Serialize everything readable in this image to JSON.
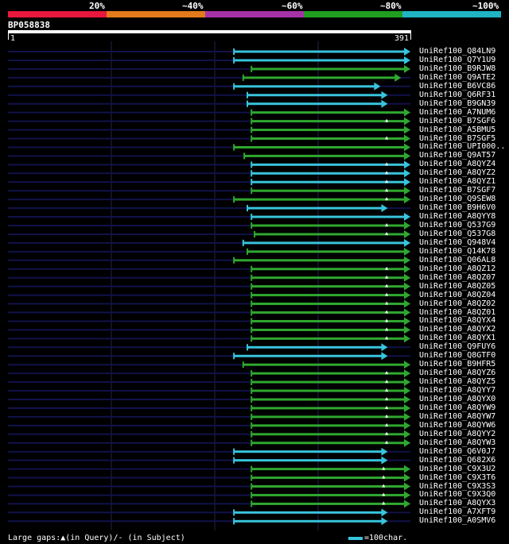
{
  "scale_labels": [
    "20%",
    "~40%",
    "~60%",
    "~80%",
    "~100%"
  ],
  "scale_colors": [
    "#e8173c",
    "#e37b1c",
    "#a632a8",
    "#1f9e1f",
    "#1fb3c4"
  ],
  "query": {
    "id": "BP058838",
    "start": "1",
    "end": "391",
    "length": 391
  },
  "colors": {
    "background": "#000000",
    "cyan": "#38c4dc",
    "green": "#2fa82f",
    "navy": "#11124a",
    "grid": "#22234e"
  },
  "hits": [
    {
      "label": "UniRef100_Q84LN9",
      "start": 220,
      "end": 391,
      "color": "cyan",
      "fade": "navy"
    },
    {
      "label": "UniRef100_Q7Y1U9",
      "start": 220,
      "end": 391,
      "color": "cyan",
      "fade": "navy"
    },
    {
      "label": "UniRef100_B9RJW8",
      "start": 237,
      "end": 391,
      "color": "green",
      "fade": "navy"
    },
    {
      "label": "UniRef100_Q9ATE2",
      "start": 229,
      "end": 382,
      "color": "green",
      "fade": "navy"
    },
    {
      "label": "UniRef100_B6VC86",
      "start": 220,
      "end": 362,
      "color": "cyan",
      "fade": "navy"
    },
    {
      "label": "UniRef100_Q6RF31",
      "start": 233,
      "end": 369,
      "color": "cyan",
      "fade": "navy"
    },
    {
      "label": "UniRef100_B9GN39",
      "start": 233,
      "end": 369,
      "color": "cyan",
      "fade": "navy"
    },
    {
      "label": "UniRef100_A7NUM6",
      "start": 237,
      "end": 391,
      "color": "green",
      "fade": "navy"
    },
    {
      "label": "UniRef100_B7SGF6",
      "start": 237,
      "end": 391,
      "color": "green",
      "fade": "navy",
      "marker": 368
    },
    {
      "label": "UniRef100_A5BMU5",
      "start": 237,
      "end": 391,
      "color": "green",
      "fade": "navy"
    },
    {
      "label": "UniRef100_B7SGF5",
      "start": 237,
      "end": 391,
      "color": "green",
      "fade": "navy",
      "marker": 368
    },
    {
      "label": "UniRef100_UPI000..",
      "start": 220,
      "end": 391,
      "color": "green",
      "fade": "navy"
    },
    {
      "label": "UniRef100_Q9AT57",
      "start": 230,
      "end": 391,
      "color": "green",
      "fade": "navy"
    },
    {
      "label": "UniRef100_A8QYZ4",
      "start": 237,
      "end": 391,
      "color": "cyan",
      "fade": "navy",
      "marker": 368
    },
    {
      "label": "UniRef100_A8QYZ2",
      "start": 237,
      "end": 391,
      "color": "cyan",
      "fade": "navy",
      "marker": 368
    },
    {
      "label": "UniRef100_A8QYZ1",
      "start": 237,
      "end": 391,
      "color": "cyan",
      "fade": "navy",
      "marker": 368
    },
    {
      "label": "UniRef100_B7SGF7",
      "start": 237,
      "end": 391,
      "color": "green",
      "fade": "navy",
      "marker": 368
    },
    {
      "label": "UniRef100_Q9SEW8",
      "start": 220,
      "end": 391,
      "color": "green",
      "fade": "navy",
      "marker": 368
    },
    {
      "label": "UniRef100_B9H6V0",
      "start": 233,
      "end": 369,
      "color": "cyan",
      "fade": "navy"
    },
    {
      "label": "UniRef100_A8QYY8",
      "start": 237,
      "end": 391,
      "color": "cyan",
      "fade": "navy"
    },
    {
      "label": "UniRef100_Q537G9",
      "start": 237,
      "end": 391,
      "color": "green",
      "fade": "navy",
      "marker": 368
    },
    {
      "label": "UniRef100_Q537G8",
      "start": 240,
      "end": 391,
      "color": "green",
      "fade": "navy",
      "marker": 368
    },
    {
      "label": "UniRef100_Q948V4",
      "start": 229,
      "end": 391,
      "color": "cyan",
      "fade": "navy"
    },
    {
      "label": "UniRef100_Q14K78",
      "start": 233,
      "end": 391,
      "color": "green",
      "fade": "navy"
    },
    {
      "label": "UniRef100_Q06AL8",
      "start": 220,
      "end": 391,
      "color": "green",
      "fade": "navy"
    },
    {
      "label": "UniRef100_A8QZ12",
      "start": 237,
      "end": 391,
      "color": "green",
      "fade": "navy",
      "marker": 368
    },
    {
      "label": "UniRef100_A8QZ07",
      "start": 237,
      "end": 391,
      "color": "green",
      "fade": "navy",
      "marker": 368
    },
    {
      "label": "UniRef100_A8QZ05",
      "start": 237,
      "end": 391,
      "color": "green",
      "fade": "navy",
      "marker": 368
    },
    {
      "label": "UniRef100_A8QZ04",
      "start": 237,
      "end": 391,
      "color": "green",
      "fade": "navy",
      "marker": 368
    },
    {
      "label": "UniRef100_A8QZ02",
      "start": 237,
      "end": 391,
      "color": "green",
      "fade": "navy",
      "marker": 368
    },
    {
      "label": "UniRef100_A8QZ01",
      "start": 237,
      "end": 391,
      "color": "green",
      "fade": "navy",
      "marker": 368
    },
    {
      "label": "UniRef100_A8QYX4",
      "start": 237,
      "end": 391,
      "color": "green",
      "fade": "navy",
      "marker": 368
    },
    {
      "label": "UniRef100_A8QYX2",
      "start": 237,
      "end": 391,
      "color": "green",
      "fade": "navy",
      "marker": 368
    },
    {
      "label": "UniRef100_A8QYX1",
      "start": 237,
      "end": 391,
      "color": "green",
      "fade": "navy",
      "marker": 368
    },
    {
      "label": "UniRef100_Q9FUY6",
      "start": 233,
      "end": 369,
      "color": "cyan",
      "fade": "navy"
    },
    {
      "label": "UniRef100_Q8GTF0",
      "start": 220,
      "end": 369,
      "color": "cyan",
      "fade": "navy"
    },
    {
      "label": "UniRef100_B9HFR5",
      "start": 229,
      "end": 391,
      "color": "green",
      "fade": "navy"
    },
    {
      "label": "UniRef100_A8QYZ6",
      "start": 237,
      "end": 391,
      "color": "green",
      "fade": "navy",
      "marker": 368
    },
    {
      "label": "UniRef100_A8QYZ5",
      "start": 237,
      "end": 391,
      "color": "green",
      "fade": "navy",
      "marker": 368
    },
    {
      "label": "UniRef100_A8QYY7",
      "start": 237,
      "end": 391,
      "color": "green",
      "fade": "navy",
      "marker": 368
    },
    {
      "label": "UniRef100_A8QYX0",
      "start": 237,
      "end": 391,
      "color": "green",
      "fade": "navy",
      "marker": 368
    },
    {
      "label": "UniRef100_A8QYW9",
      "start": 237,
      "end": 391,
      "color": "green",
      "fade": "navy",
      "marker": 368
    },
    {
      "label": "UniRef100_A8QYW7",
      "start": 237,
      "end": 391,
      "color": "green",
      "fade": "navy",
      "marker": 368
    },
    {
      "label": "UniRef100_A8QYW6",
      "start": 237,
      "end": 391,
      "color": "green",
      "fade": "navy",
      "marker": 368
    },
    {
      "label": "UniRef100_A8QYY2",
      "start": 237,
      "end": 391,
      "color": "green",
      "fade": "navy",
      "marker": 368
    },
    {
      "label": "UniRef100_A8QYW3",
      "start": 237,
      "end": 391,
      "color": "green",
      "fade": "navy",
      "marker": 368
    },
    {
      "label": "UniRef100_Q6V0J7",
      "start": 220,
      "end": 369,
      "color": "cyan",
      "fade": "navy"
    },
    {
      "label": "UniRef100_Q682X6",
      "start": 220,
      "end": 369,
      "color": "cyan",
      "fade": "navy"
    },
    {
      "label": "UniRef100_C9X3U2",
      "start": 237,
      "end": 391,
      "color": "green",
      "fade": "navy",
      "marker": 365
    },
    {
      "label": "UniRef100_C9X3T6",
      "start": 237,
      "end": 391,
      "color": "green",
      "fade": "navy",
      "marker": 365
    },
    {
      "label": "UniRef100_C9X3S3",
      "start": 237,
      "end": 391,
      "color": "green",
      "fade": "navy",
      "marker": 365
    },
    {
      "label": "UniRef100_C9X3Q0",
      "start": 237,
      "end": 391,
      "color": "green",
      "fade": "navy",
      "marker": 365
    },
    {
      "label": "UniRef100_A8QYX3",
      "start": 237,
      "end": 391,
      "color": "green",
      "fade": "navy",
      "marker": 365
    },
    {
      "label": "UniRef100_A7XFT9",
      "start": 220,
      "end": 369,
      "color": "cyan",
      "fade": "navy"
    },
    {
      "label": "UniRef100_A0SMV6",
      "start": 220,
      "end": 369,
      "color": "cyan",
      "fade": "navy"
    }
  ],
  "footer": {
    "gaps_text": "Large gaps:▲(in Query)/- (in Subject)",
    "legend_text": "=100char."
  }
}
